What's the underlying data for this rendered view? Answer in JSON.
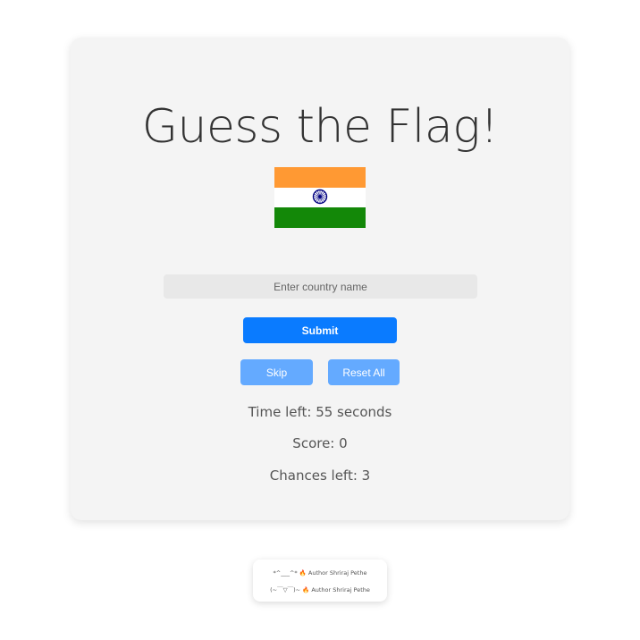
{
  "game": {
    "title": "Guess the Flag!",
    "flag": {
      "icon": "india-flag",
      "colors": {
        "saffron": "#ff9933",
        "white": "#ffffff",
        "green": "#138808",
        "chakra": "#000080"
      }
    },
    "input": {
      "value": "",
      "placeholder": "Enter country name"
    },
    "buttons": {
      "submit": "Submit",
      "skip": "Skip",
      "reset_all": "Reset All"
    },
    "stats": {
      "time_left": "Time left: 55 seconds",
      "score": "Score: 0",
      "chances_left": "Chances left: 3"
    },
    "accent_colors": {
      "submit": "#0a7bff",
      "secondary": "#64aaff"
    }
  },
  "footer": {
    "line1": "*^___^* 🔥 Author Shriraj Pethe",
    "line2": "(~￣▽￣)~ 🔥 Author Shriraj Pethe"
  }
}
